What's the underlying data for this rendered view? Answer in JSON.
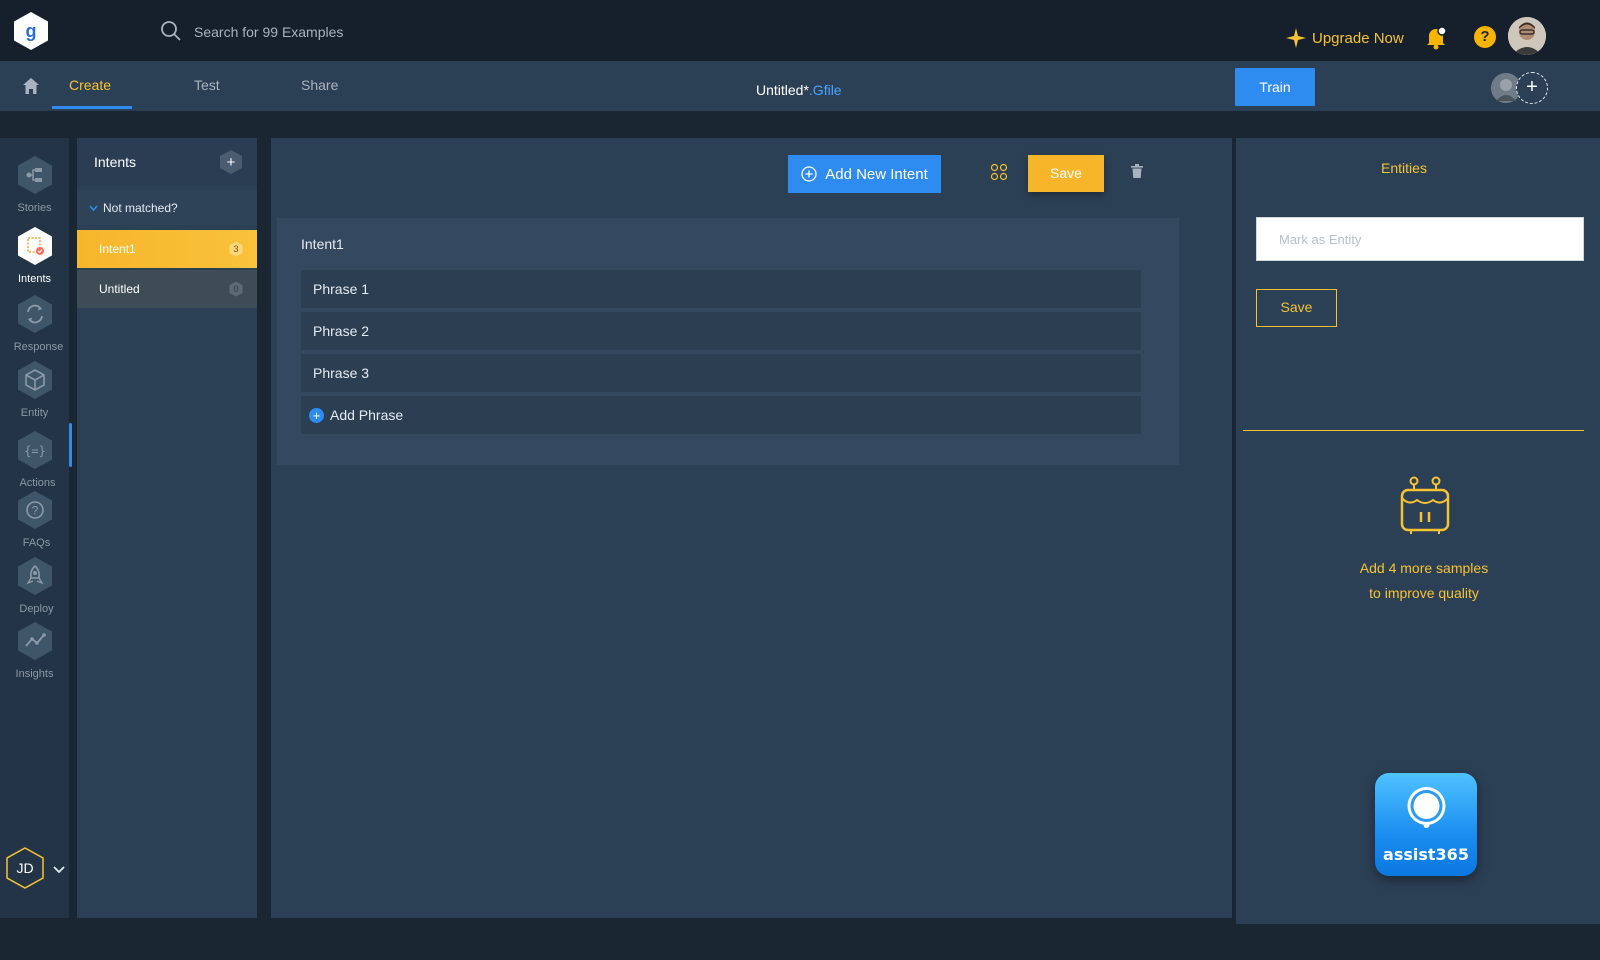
{
  "app": {
    "logo_letter": "g",
    "search_placeholder": "Search for 99 Examples",
    "upgrade_label": "Upgrade Now",
    "help_glyph": "?"
  },
  "nav": {
    "tabs": [
      {
        "label": "Create",
        "active": true
      },
      {
        "label": "Test",
        "active": false
      },
      {
        "label": "Share",
        "active": false
      }
    ],
    "file_name": "Untitled*",
    "file_ext": ".Gfile",
    "train_label": "Train",
    "add_collaborator": "+"
  },
  "rail": {
    "items": [
      {
        "label": "Stories",
        "icon": "stories-icon",
        "active": false
      },
      {
        "label": "Intents",
        "icon": "intents-icon",
        "active": true
      },
      {
        "label": "Response",
        "icon": "response-icon",
        "active": false
      },
      {
        "label": "Entity",
        "icon": "entity-icon",
        "active": false
      },
      {
        "label": "Actions",
        "icon": "actions-icon",
        "active": false
      },
      {
        "label": "FAQs",
        "icon": "faqs-icon",
        "active": false
      },
      {
        "label": "Deploy",
        "icon": "deploy-icon",
        "active": false
      },
      {
        "label": "Insights",
        "icon": "insights-icon",
        "active": false
      }
    ],
    "user_initials": "JD"
  },
  "intents": {
    "title": "Intents",
    "add_glyph": "+",
    "group_label": "Not matched?",
    "items": [
      {
        "name": "Intent1",
        "count": "3",
        "selected": true
      },
      {
        "name": "Untitled",
        "count": "0",
        "selected": false
      }
    ]
  },
  "editor": {
    "add_intent_label": "Add New Intent",
    "save_label": "Save",
    "intent_title": "Intent1",
    "phrases": [
      "Phrase 1",
      "Phrase 2",
      "Phrase 3"
    ],
    "add_phrase_label": "Add Phrase",
    "add_phrase_glyph": "+"
  },
  "entities": {
    "title": "Entities",
    "input_placeholder": "Mark as Entity",
    "save_label": "Save",
    "quality_line1": "Add 4 more samples",
    "quality_line2": "to improve quality"
  },
  "assistant": {
    "label": "assist365"
  },
  "colors": {
    "accent_blue": "#2e8cf0",
    "accent_yellow": "#f7c233",
    "panel": "#2c4055",
    "background": "#1b2633"
  }
}
